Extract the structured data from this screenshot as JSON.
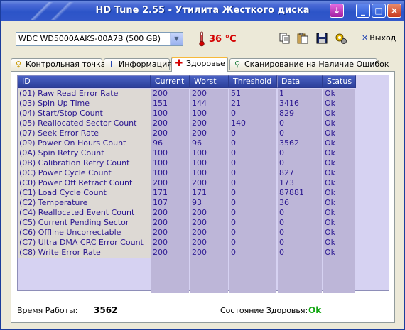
{
  "window": {
    "title": "HD Tune 2.55 - Утилита Жесткого диска",
    "buttons": {
      "download": "↓",
      "minimize": "_",
      "maximize": "□",
      "close": "×"
    }
  },
  "toolbar": {
    "drive": "WDC WD5000AAKS-00A7B (500 GB)",
    "temperature": "36 °C",
    "icons": [
      "copy-icon",
      "paste-icon",
      "save-icon",
      "options-icon"
    ],
    "exit_label": "Выход"
  },
  "tabs": [
    {
      "label": "Контрольная точка",
      "icon": "lightbulb-icon",
      "active": false
    },
    {
      "label": "Информация",
      "icon": "info-icon",
      "active": false
    },
    {
      "label": "Здоровье",
      "icon": "health-cross-icon",
      "active": true
    },
    {
      "label": "Сканирование на Наличие Ошибок",
      "icon": "magnifier-icon",
      "active": false
    }
  ],
  "health_table": {
    "columns": [
      "ID",
      "Current",
      "Worst",
      "Threshold",
      "Data",
      "Status"
    ],
    "rows": [
      [
        "(01) Raw Read Error Rate",
        "200",
        "200",
        "51",
        "1",
        "Ok"
      ],
      [
        "(03) Spin Up Time",
        "151",
        "144",
        "21",
        "3416",
        "Ok"
      ],
      [
        "(04) Start/Stop Count",
        "100",
        "100",
        "0",
        "829",
        "Ok"
      ],
      [
        "(05) Reallocated Sector Count",
        "200",
        "200",
        "140",
        "0",
        "Ok"
      ],
      [
        "(07) Seek Error Rate",
        "200",
        "200",
        "0",
        "0",
        "Ok"
      ],
      [
        "(09) Power On Hours Count",
        "96",
        "96",
        "0",
        "3562",
        "Ok"
      ],
      [
        "(0A) Spin Retry Count",
        "100",
        "100",
        "0",
        "0",
        "Ok"
      ],
      [
        "(0B) Calibration Retry Count",
        "100",
        "100",
        "0",
        "0",
        "Ok"
      ],
      [
        "(0C) Power Cycle Count",
        "100",
        "100",
        "0",
        "827",
        "Ok"
      ],
      [
        "(C0) Power Off Retract Count",
        "200",
        "200",
        "0",
        "173",
        "Ok"
      ],
      [
        "(C1) Load Cycle Count",
        "171",
        "171",
        "0",
        "87881",
        "Ok"
      ],
      [
        "(C2) Temperature",
        "107",
        "93",
        "0",
        "36",
        "Ok"
      ],
      [
        "(C4) Reallocated Event Count",
        "200",
        "200",
        "0",
        "0",
        "Ok"
      ],
      [
        "(C5) Current Pending Sector",
        "200",
        "200",
        "0",
        "0",
        "Ok"
      ],
      [
        "(C6) Offline Uncorrectable",
        "200",
        "200",
        "0",
        "0",
        "Ok"
      ],
      [
        "(C7) Ultra DMA CRC Error Count",
        "200",
        "200",
        "0",
        "0",
        "Ok"
      ],
      [
        "(C8) Write Error Rate",
        "200",
        "200",
        "0",
        "0",
        "Ok"
      ]
    ]
  },
  "footer": {
    "uptime_label": "Время Работы:",
    "uptime_value": "3562",
    "health_label": "Состояние Здоровья:",
    "health_value": "Ok"
  },
  "colors": {
    "titlebar": "#2c54c8",
    "temperature": "#d40000",
    "health_ok": "#14a814",
    "grid_text": "#2a1690",
    "grid_header": "#2c3f9a"
  }
}
